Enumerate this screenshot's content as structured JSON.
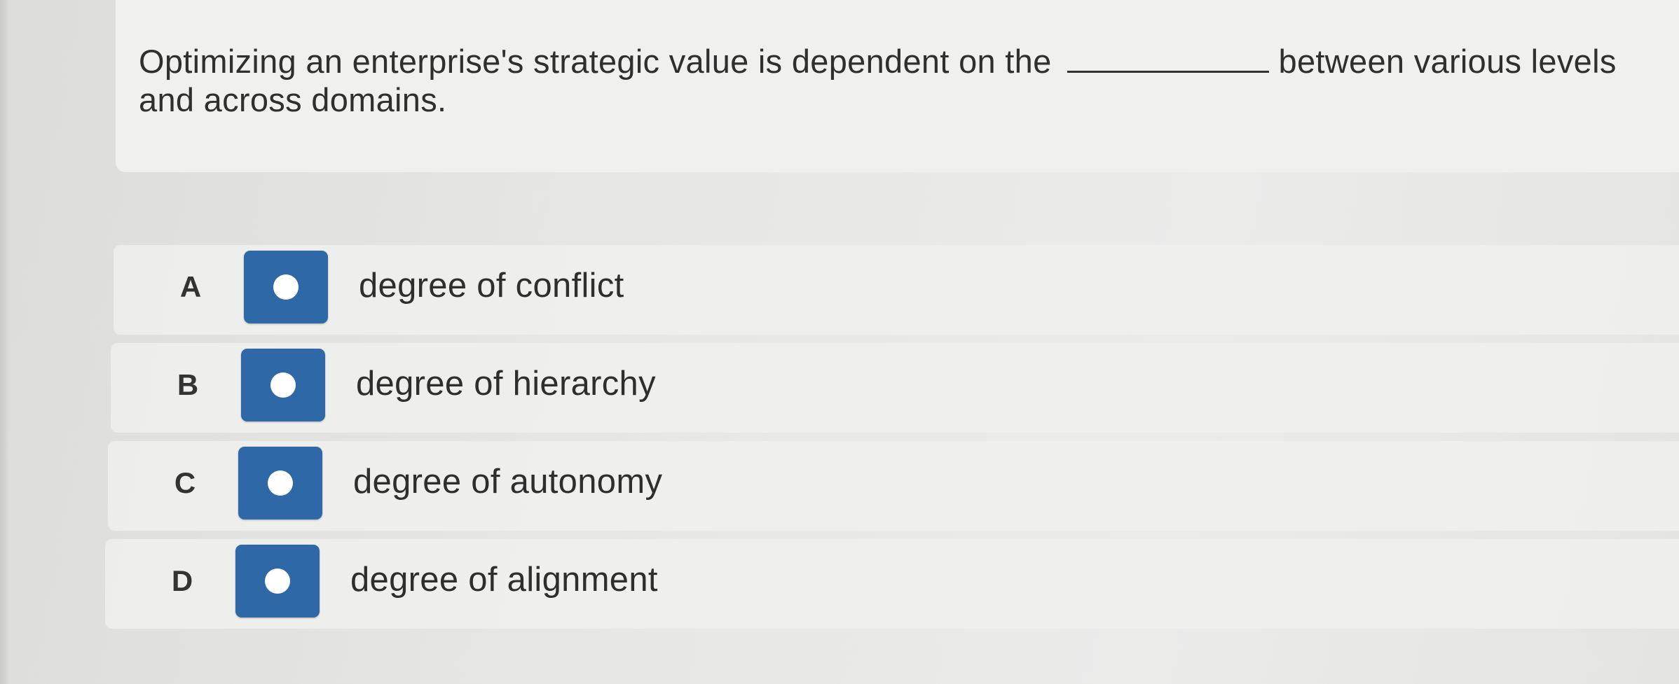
{
  "question": {
    "text_before": "Optimizing an enterprise's strategic value is dependent on the",
    "text_after": "between various levels and across domains."
  },
  "options": [
    {
      "letter": "A",
      "label": "degree of conflict"
    },
    {
      "letter": "B",
      "label": "degree of hierarchy"
    },
    {
      "letter": "C",
      "label": "degree of autonomy"
    },
    {
      "letter": "D",
      "label": "degree of alignment"
    }
  ],
  "colors": {
    "radio_fill": "#2e68a6",
    "radio_dot": "#ffffff"
  }
}
